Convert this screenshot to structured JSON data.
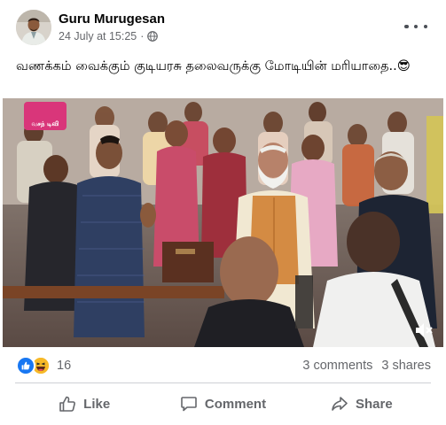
{
  "post": {
    "author": "Guru Murugesan",
    "timestamp": "24 July at 15:25",
    "separator": "·",
    "audience_icon": "globe-icon",
    "more_icon": "more-horizontal-icon",
    "caption": "வணக்கம் வைக்கும் குடியரசு தலைவருக்கு மோடியின் மரியாதை..😎"
  },
  "video": {
    "channel_logo_text": "வசந் டிவி",
    "mute_icon": "volume-muted-icon"
  },
  "counts": {
    "reaction_icons": [
      "like-icon",
      "haha-icon"
    ],
    "reactions": "16",
    "comments": "3 comments",
    "shares": "3 shares"
  },
  "actions": {
    "like": "Like",
    "comment": "Comment",
    "share": "Share"
  },
  "colors": {
    "like_blue": "#1877f2",
    "haha_yellow": "#f7b928",
    "secondary_text": "#65676b",
    "divider": "#ced0d4"
  }
}
